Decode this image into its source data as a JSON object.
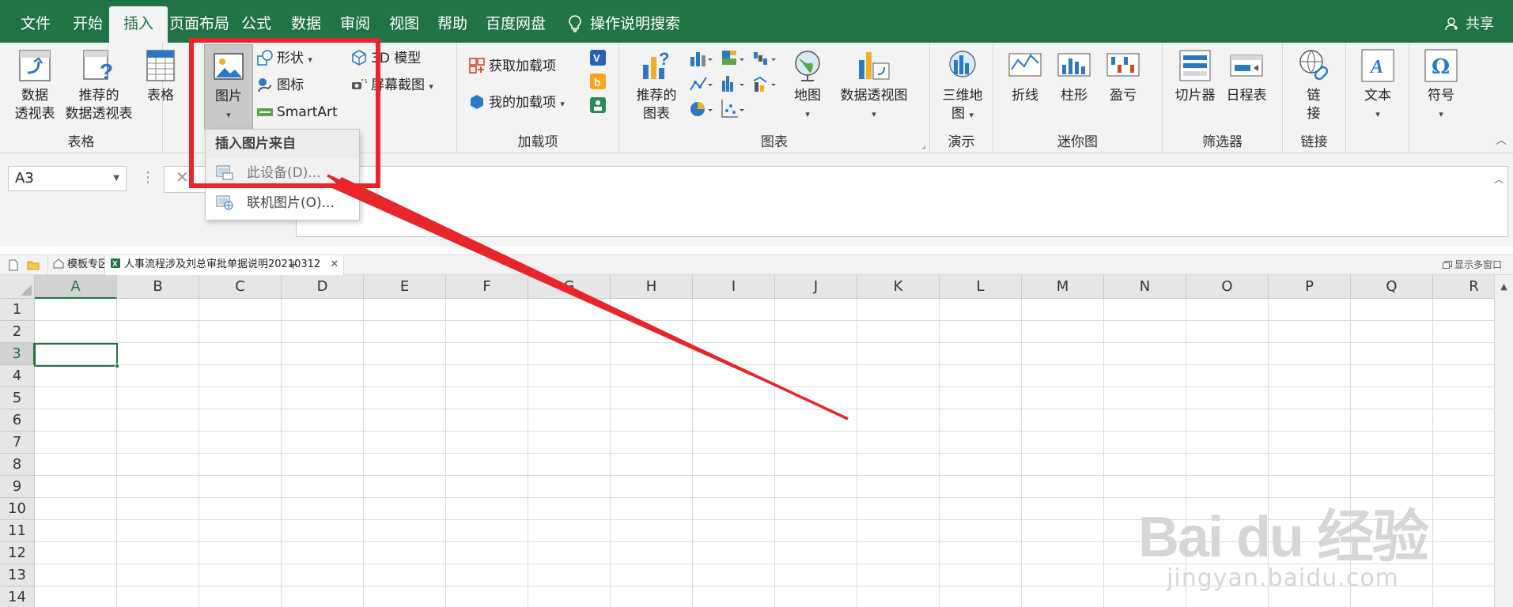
{
  "tabs": [
    "文件",
    "开始",
    "插入",
    "页面布局",
    "公式",
    "数据",
    "审阅",
    "视图",
    "帮助",
    "百度网盘"
  ],
  "active_tab": "插入",
  "tell_me": "操作说明搜索",
  "share": "共享",
  "ribbon": {
    "tables": {
      "pivot": [
        "数据",
        "透视表"
      ],
      "recommended_pivot": [
        "推荐的",
        "数据透视表"
      ],
      "table": "表格",
      "label": "表格"
    },
    "illustrations": {
      "pictures": "图片",
      "shapes": "形状",
      "icons": "图标",
      "smartart": "SmartArt",
      "model3d": "3D 模型",
      "screenshot": "屏幕截图"
    },
    "addins": {
      "get": "获取加载项",
      "mine": "我的加载项",
      "label": "加载项"
    },
    "charts": {
      "recommended": [
        "推荐的",
        "图表"
      ],
      "maps": "地图",
      "pivot_chart": "数据透视图",
      "label": "图表"
    },
    "tours": {
      "map3d": [
        "三维地",
        "图"
      ],
      "label": "演示"
    },
    "sparklines": {
      "line": "折线",
      "column": "柱形",
      "winloss": "盈亏",
      "label": "迷你图"
    },
    "filters": {
      "slicer": "切片器",
      "timeline": "日程表",
      "label": "筛选器"
    },
    "links": {
      "link": [
        "链",
        "接"
      ],
      "label": "链接"
    },
    "text": "文本",
    "symbols": "符号"
  },
  "name_box": "A3",
  "doc_tabs": {
    "template": "模板专区",
    "file": "人事流程涉及刘总审批单据说明20210312",
    "multi_window": "显示多窗口"
  },
  "columns": [
    "A",
    "B",
    "C",
    "D",
    "E",
    "F",
    "G",
    "H",
    "I",
    "J",
    "K",
    "L",
    "M",
    "N",
    "O",
    "P",
    "Q",
    "R"
  ],
  "rows": [
    "1",
    "2",
    "3",
    "4",
    "5",
    "6",
    "7",
    "8",
    "9",
    "10",
    "11",
    "12",
    "13",
    "14"
  ],
  "selected_cell": "A3",
  "menu": {
    "header": "插入图片来自",
    "items": [
      "此设备(D)...",
      "联机图片(O)..."
    ]
  },
  "watermark": {
    "logo": "Bai du 经验",
    "url": "jingyan.baidu.com"
  },
  "colors": {
    "excel_green": "#217346",
    "annotation_red": "#e8252b",
    "ribbon_bg": "#f3f3f3"
  }
}
